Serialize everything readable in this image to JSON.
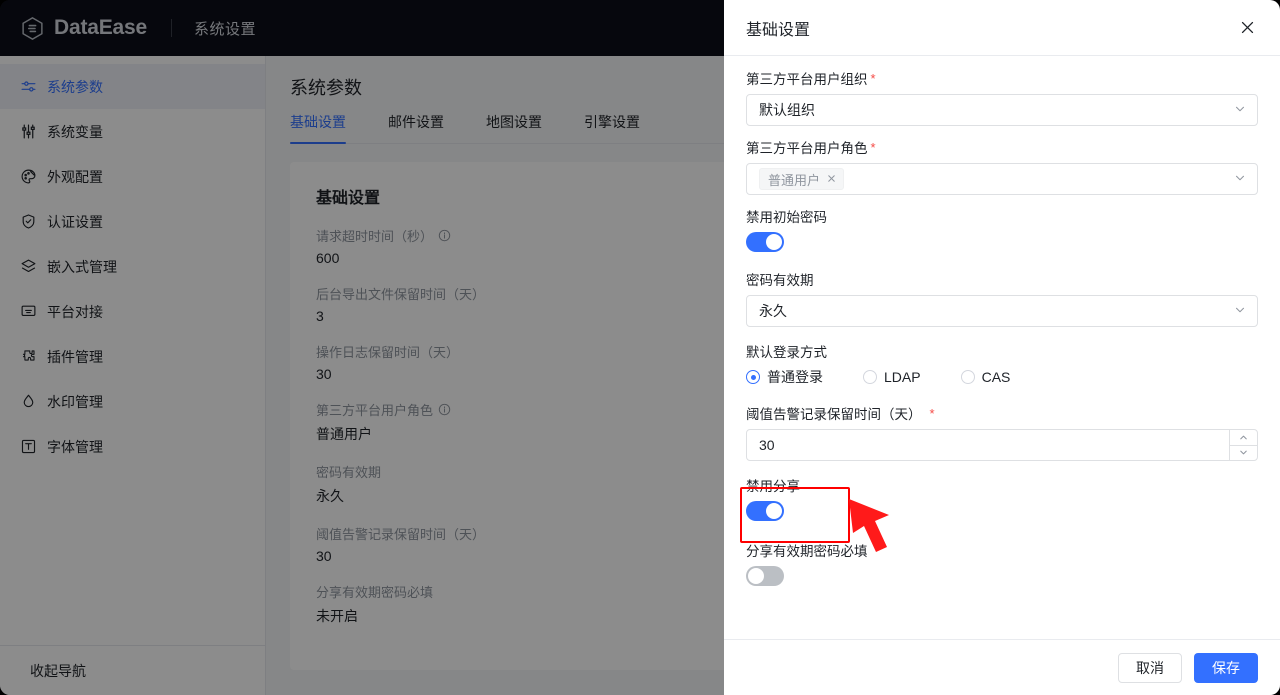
{
  "topbar": {
    "brand": "DataEase",
    "section_title": "系统设置",
    "logo_icon": "dataease-hex-logo"
  },
  "sidebar": {
    "items": [
      {
        "label": "系统参数",
        "icon": "sliders-horizontal-icon",
        "active": true
      },
      {
        "label": "系统变量",
        "icon": "sliders-vertical-icon",
        "active": false
      },
      {
        "label": "外观配置",
        "icon": "palette-icon",
        "active": false
      },
      {
        "label": "认证设置",
        "icon": "shield-check-icon",
        "active": false
      },
      {
        "label": "嵌入式管理",
        "icon": "layers-icon",
        "active": false
      },
      {
        "label": "平台对接",
        "icon": "monitor-icon",
        "active": false
      },
      {
        "label": "插件管理",
        "icon": "puzzle-icon",
        "active": false
      },
      {
        "label": "水印管理",
        "icon": "droplet-icon",
        "active": false
      },
      {
        "label": "字体管理",
        "icon": "text-box-icon",
        "active": false
      }
    ],
    "collapse": {
      "label": "收起导航",
      "icon": "collapse-nav-icon"
    }
  },
  "main": {
    "page_title": "系统参数",
    "tabs": [
      {
        "label": "基础设置",
        "active": true
      },
      {
        "label": "邮件设置",
        "active": false
      },
      {
        "label": "地图设置",
        "active": false
      },
      {
        "label": "引擎设置",
        "active": false
      }
    ],
    "card_title": "基础设置",
    "rows": [
      {
        "label": "请求超时时间（秒）",
        "value": "600",
        "info": true
      },
      {
        "label": "后台导出文件保留时间（天）",
        "value": "3",
        "info": false
      },
      {
        "label": "操作日志保留时间（天）",
        "value": "30",
        "info": false
      },
      {
        "label": "第三方平台用户角色",
        "value": "普通用户",
        "info": true
      },
      {
        "label": "密码有效期",
        "value": "永久",
        "info": false
      },
      {
        "label": "阈值告警记录保留时间（天）",
        "value": "30",
        "info": false
      },
      {
        "label": "分享有效期密码必填",
        "value": "未开启",
        "info": false
      }
    ]
  },
  "drawer": {
    "title": "基础设置",
    "close_icon": "close-icon",
    "fields": {
      "org": {
        "label": "第三方平台用户组织",
        "required": true,
        "value": "默认组织",
        "caret_icon": "chevron-down-icon"
      },
      "role": {
        "label": "第三方平台用户角色",
        "required": true,
        "tag": "普通用户",
        "tag_remove_icon": "close-small-icon",
        "caret_icon": "chevron-down-icon"
      },
      "disable_initial_password": {
        "label": "禁用初始密码",
        "state": "on"
      },
      "password_validity": {
        "label": "密码有效期",
        "value": "永久",
        "caret_icon": "chevron-down-icon"
      },
      "default_login": {
        "label": "默认登录方式",
        "options": [
          {
            "label": "普通登录",
            "checked": true
          },
          {
            "label": "LDAP",
            "checked": false
          },
          {
            "label": "CAS",
            "checked": false
          }
        ]
      },
      "alert_retention": {
        "label": "阈值告警记录保留时间（天）",
        "required": true,
        "value": "30",
        "step_up_icon": "chevron-up-icon",
        "step_down_icon": "chevron-down-icon"
      },
      "disable_share": {
        "label": "禁用分享",
        "state": "on",
        "highlighted": true
      },
      "share_password_required": {
        "label": "分享有效期密码必填",
        "state": "off"
      }
    },
    "footer": {
      "cancel_label": "取消",
      "save_label": "保存"
    }
  },
  "annotation": {
    "highlight_color": "#ff0000",
    "arrow_icon": "red-pointer-arrow"
  },
  "colors": {
    "accent": "#3370ff",
    "topbar_bg": "#0c0e18",
    "required_star": "#f54a45",
    "toggle_off": "#bbbfc4",
    "highlight": "#ff0000"
  }
}
